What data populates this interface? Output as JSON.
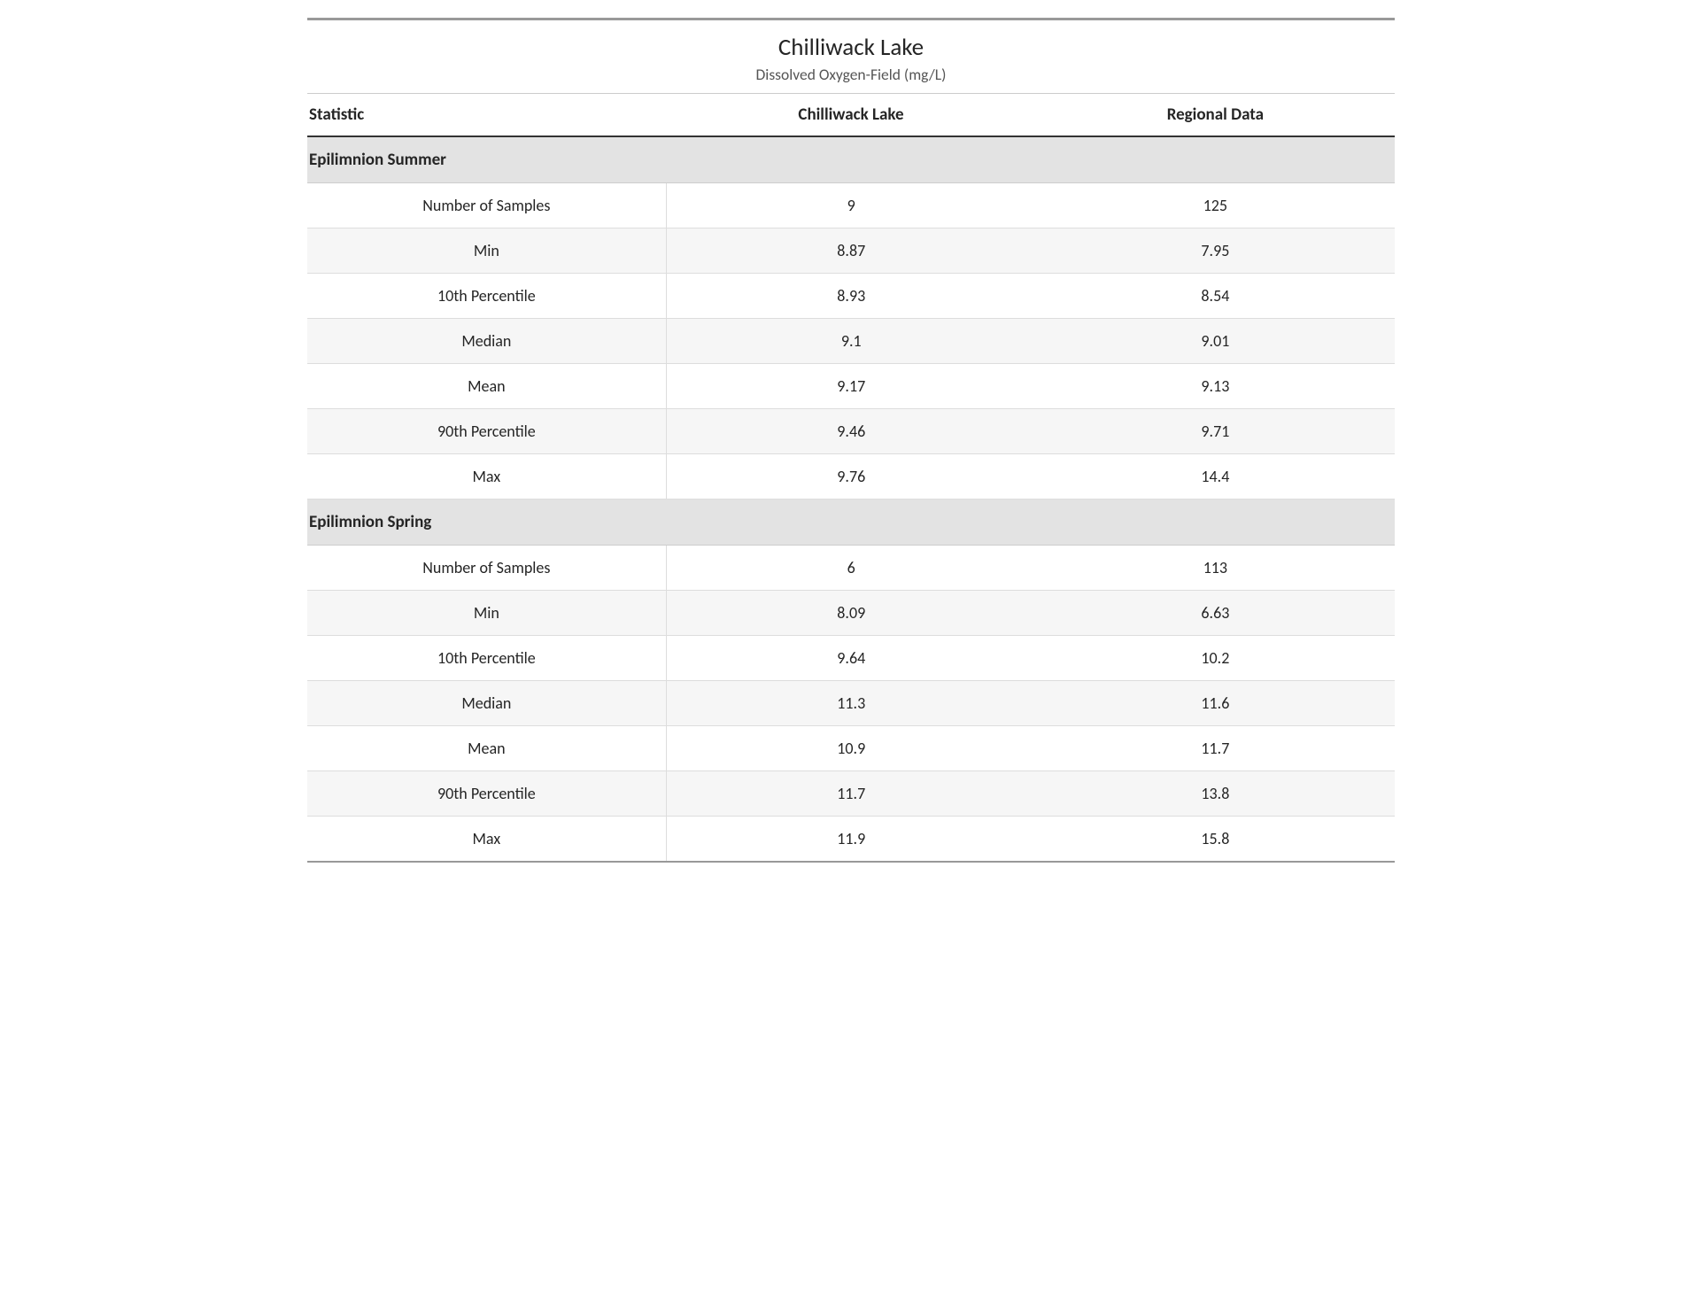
{
  "title": "Chilliwack Lake",
  "subtitle": "Dissolved Oxygen-Field (mg/L)",
  "columns": {
    "stat": "Statistic",
    "lake": "Chilliwack Lake",
    "regional": "Regional Data"
  },
  "stat_labels": {
    "samples": "Number of Samples",
    "min": "Min",
    "p10": "10th Percentile",
    "median": "Median",
    "mean": "Mean",
    "p90": "90th Percentile",
    "max": "Max"
  },
  "sections": [
    {
      "name": "Epilimnion Summer",
      "rows": [
        {
          "stat": "samples",
          "lake": "9",
          "regional": "125"
        },
        {
          "stat": "min",
          "lake": "8.87",
          "regional": "7.95"
        },
        {
          "stat": "p10",
          "lake": "8.93",
          "regional": "8.54"
        },
        {
          "stat": "median",
          "lake": "9.1",
          "regional": "9.01"
        },
        {
          "stat": "mean",
          "lake": "9.17",
          "regional": "9.13"
        },
        {
          "stat": "p90",
          "lake": "9.46",
          "regional": "9.71"
        },
        {
          "stat": "max",
          "lake": "9.76",
          "regional": "14.4"
        }
      ]
    },
    {
      "name": "Epilimnion Spring",
      "rows": [
        {
          "stat": "samples",
          "lake": "6",
          "regional": "113"
        },
        {
          "stat": "min",
          "lake": "8.09",
          "regional": "6.63"
        },
        {
          "stat": "p10",
          "lake": "9.64",
          "regional": "10.2"
        },
        {
          "stat": "median",
          "lake": "11.3",
          "regional": "11.6"
        },
        {
          "stat": "mean",
          "lake": "10.9",
          "regional": "11.7"
        },
        {
          "stat": "p90",
          "lake": "11.7",
          "regional": "13.8"
        },
        {
          "stat": "max",
          "lake": "11.9",
          "regional": "15.8"
        }
      ]
    }
  ]
}
